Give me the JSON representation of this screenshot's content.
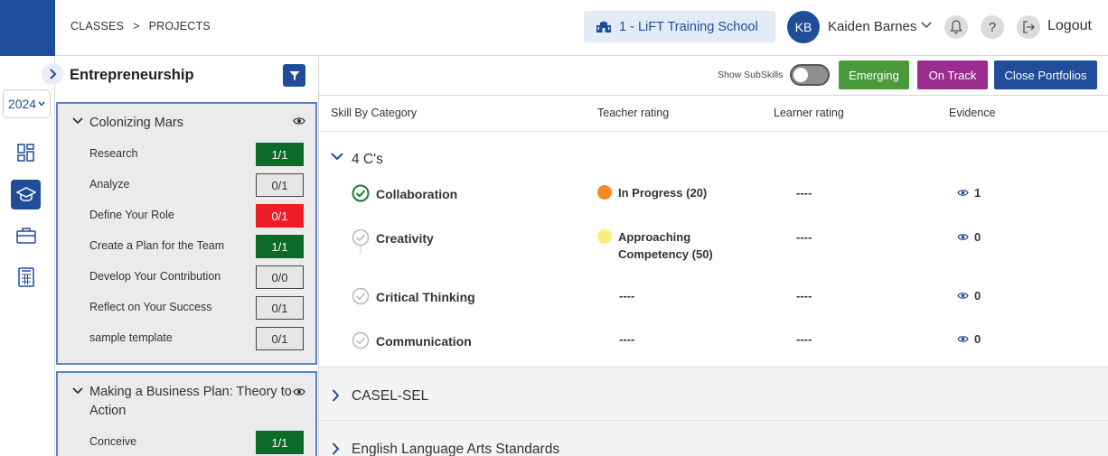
{
  "breadcrumb": {
    "first": "CLASSES",
    "separator": ">",
    "second": "PROJECTS"
  },
  "header": {
    "school": "1 - LiFT Training School",
    "avatar_initials": "KB",
    "user_name": "Kaiden Barnes",
    "help_glyph": "?",
    "logout_label": "Logout"
  },
  "rail": {
    "year": "2024",
    "icons": [
      "dashboard-icon",
      "graduation-cap-icon",
      "briefcase-icon",
      "spreadsheet-icon"
    ],
    "active_index": 1
  },
  "panel": {
    "title": "Entrepreneurship",
    "projects": [
      {
        "name": "Colonizing Mars",
        "tasks": [
          {
            "label": "Research",
            "score": "1/1",
            "status": "green"
          },
          {
            "label": "Analyze",
            "score": "0/1",
            "status": "gray"
          },
          {
            "label": "Define Your Role",
            "score": "0/1",
            "status": "red"
          },
          {
            "label": "Create a Plan for the Team",
            "score": "1/1",
            "status": "green"
          },
          {
            "label": "Develop Your Contribution",
            "score": "0/0",
            "status": "gray"
          },
          {
            "label": "Reflect on Your Success",
            "score": "0/1",
            "status": "gray"
          },
          {
            "label": "sample template",
            "score": "0/1",
            "status": "gray"
          }
        ]
      },
      {
        "name": "Making a Business Plan: Theory to Action",
        "tasks": [
          {
            "label": "Conceive",
            "score": "1/1",
            "status": "green"
          }
        ]
      }
    ]
  },
  "toolbar": {
    "subskills_label": "Show SubSkills",
    "emerging_label": "Emerging",
    "ontrack_label": "On Track",
    "close_label": "Close Portfolios",
    "colors": {
      "emerging": "#4a9a3b",
      "ontrack": "#9b2d8e",
      "close": "#1f4d9a"
    }
  },
  "table": {
    "columns": [
      "Skill By Category",
      "Teacher rating",
      "Learner rating",
      "Evidence"
    ],
    "categories": [
      {
        "name": "4 C's",
        "expanded": true,
        "skills": [
          {
            "name": "Collaboration",
            "checked": true,
            "teacher_rating": "In Progress (20)",
            "rating_color": "#f58a26",
            "learner_rating": "----",
            "evidence": "1"
          },
          {
            "name": "Creativity",
            "checked": false,
            "teacher_rating_line1": "Approaching",
            "teacher_rating_line2": "Competency (50)",
            "rating_color": "#f7f17a",
            "learner_rating": "----",
            "evidence": "0"
          },
          {
            "name": "Critical Thinking",
            "checked": false,
            "teacher_rating": "----",
            "learner_rating": "----",
            "evidence": "0"
          },
          {
            "name": "Communication",
            "checked": false,
            "teacher_rating": "----",
            "learner_rating": "----",
            "evidence": "0"
          }
        ]
      },
      {
        "name": "CASEL-SEL",
        "expanded": false
      },
      {
        "name": "English Language Arts Standards",
        "expanded": false
      }
    ]
  }
}
